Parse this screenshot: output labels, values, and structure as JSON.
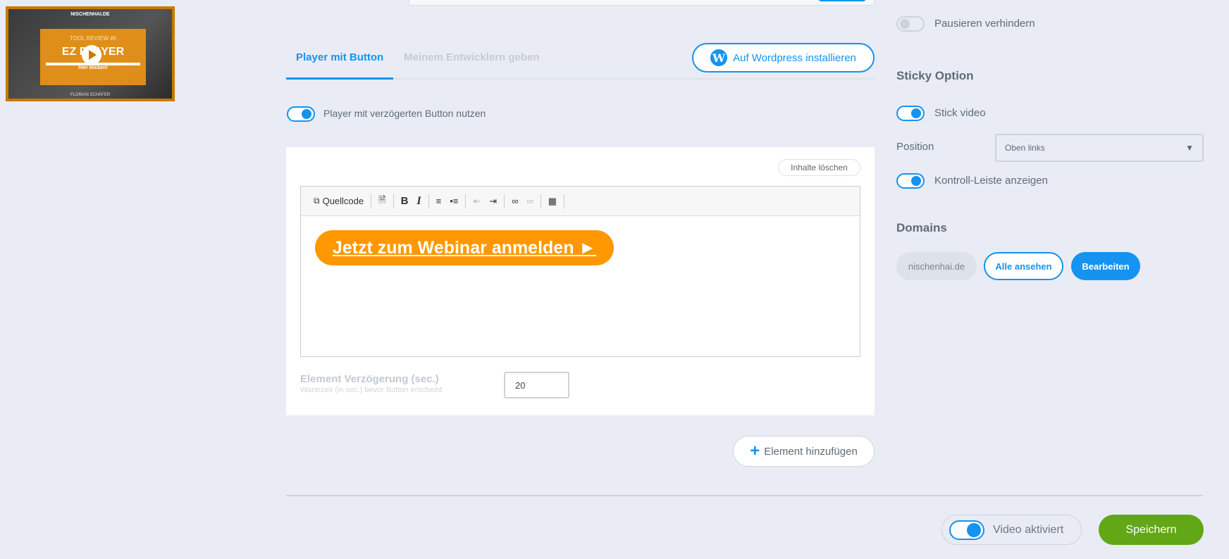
{
  "thumbnail": {
    "site": "NISCHENHAI.DE",
    "subtitle": "TOOL REVIEW #5",
    "title": "EZ PLAYER",
    "cta": "Hier klicken!",
    "author": "FLORIAN SCHÄFER"
  },
  "tabs": [
    {
      "label": "Player mit Button",
      "active": true
    },
    {
      "label": "Meinem Entwicklern geben",
      "active": false
    }
  ],
  "wordpress_button": "Auf Wordpress installieren",
  "delayed_toggle": {
    "label": "Player mit verzögerten Button nutzen",
    "on": true
  },
  "editor": {
    "clear_label": "Inhalte löschen",
    "source_label": "Quellcode",
    "content_button": "Jetzt zum Webinar anmelden ►",
    "content_color": "#ff9800"
  },
  "delay": {
    "label": "Element Verzögerung (sec.)",
    "hint": "Wartezeit (in sec.) bevor Button erscheint",
    "value": "20"
  },
  "add_element": "Element hinzufügen",
  "right": {
    "pause": {
      "label": "Pausieren verhindern",
      "on": false
    },
    "sticky_heading": "Sticky Option",
    "stick": {
      "label": "Stick video",
      "on": true
    },
    "position_label": "Position",
    "position_value": "Oben links",
    "controls": {
      "label": "Kontroll-Leiste anzeigen",
      "on": true
    },
    "domains_heading": "Domains",
    "domain": "nischenhai.de",
    "view_all": "Alle ansehen",
    "edit": "Bearbeiten"
  },
  "footer": {
    "video_active": "Video aktiviert",
    "save": "Speichern"
  },
  "colors": {
    "accent": "#1493f0",
    "save": "#62a716",
    "orange": "#ff9800"
  }
}
